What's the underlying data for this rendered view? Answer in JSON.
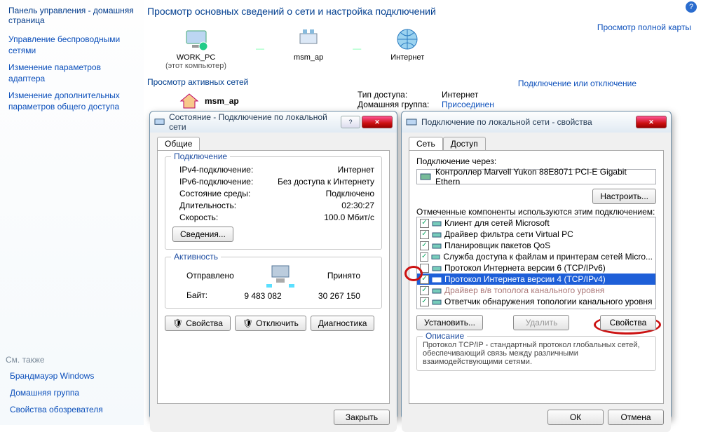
{
  "help_icon": "?",
  "sidebar": {
    "control_panel": "Панель управления - домашняя страница",
    "links": [
      "Управление беспроводными сетями",
      "Изменение параметров адаптера",
      "Изменение дополнительных параметров общего доступа"
    ],
    "see_also_hdr": "См. также",
    "see_also": [
      "Брандмауэр Windows",
      "Домашняя группа",
      "Свойства обозревателя"
    ]
  },
  "main": {
    "title": "Просмотр основных сведений о сети и настройка подключений",
    "fullmap": "Просмотр полной карты",
    "nodes": {
      "pc": {
        "name": "WORK_PC",
        "sub": "(этот компьютер)"
      },
      "ap": {
        "name": "msm_ap",
        "sub": ""
      },
      "internet": {
        "name": "Интернет",
        "sub": ""
      }
    },
    "active_hdr": "Просмотр активных сетей",
    "conn_link": "Подключение или отключение",
    "msm_label": "msm_ap",
    "type": {
      "access_lbl": "Тип доступа:",
      "access_val": "Интернет",
      "home_lbl": "Домашняя группа:",
      "home_val": "Присоединен"
    }
  },
  "status": {
    "title": "Состояние - Подключение по локальной сети",
    "tab_general": "Общие",
    "grp_conn": "Подключение",
    "ipv4_lbl": "IPv4-подключение:",
    "ipv4_val": "Интернет",
    "ipv6_lbl": "IPv6-подключение:",
    "ipv6_val": "Без доступа к Интернету",
    "media_lbl": "Состояние среды:",
    "media_val": "Подключено",
    "dur_lbl": "Длительность:",
    "dur_val": "02:30:27",
    "speed_lbl": "Скорость:",
    "speed_val": "100.0 Мбит/с",
    "details_btn": "Сведения...",
    "grp_act": "Активность",
    "sent_lbl": "Отправлено",
    "recv_lbl": "Принято",
    "bytes_lbl": "Байт:",
    "sent_val": "9 483 082",
    "recv_val": "30 267 150",
    "prop_btn": "Свойства",
    "disable_btn": "Отключить",
    "diag_btn": "Диагностика",
    "close_btn": "Закрыть"
  },
  "props": {
    "title": "Подключение по локальной сети - свойства",
    "tab_net": "Сеть",
    "tab_access": "Доступ",
    "connect_via_lbl": "Подключение через:",
    "adapter": "Контроллер Marvell Yukon 88E8071 PCI-E Gigabit Ethern",
    "configure_btn": "Настроить...",
    "components_lbl": "Отмеченные компоненты используются этим подключением:",
    "items": [
      {
        "checked": true,
        "label": "Клиент для сетей Microsoft"
      },
      {
        "checked": true,
        "label": "Драйвер фильтра сети Virtual PC"
      },
      {
        "checked": true,
        "label": "Планировщик пакетов QoS"
      },
      {
        "checked": true,
        "label": "Служба доступа к файлам и принтерам сетей Micro..."
      },
      {
        "checked": false,
        "label": "Протокол Интернета версии 6 (TCP/IPv6)"
      },
      {
        "checked": true,
        "label": "Протокол Интернета версии 4 (TCP/IPv4)",
        "selected": true
      },
      {
        "checked": true,
        "label": "Драйвер в/в тополога канального уровня",
        "dim": true
      },
      {
        "checked": true,
        "label": "Ответчик обнаружения топологии канального уровня"
      }
    ],
    "install_btn": "Установить...",
    "remove_btn": "Удалить",
    "props_btn": "Свойства",
    "desc_hdr": "Описание",
    "desc_body": "Протокол TCP/IP - стандартный протокол глобальных сетей, обеспечивающий связь между различными взаимодействующими сетями.",
    "ok_btn": "ОК",
    "cancel_btn": "Отмена"
  }
}
